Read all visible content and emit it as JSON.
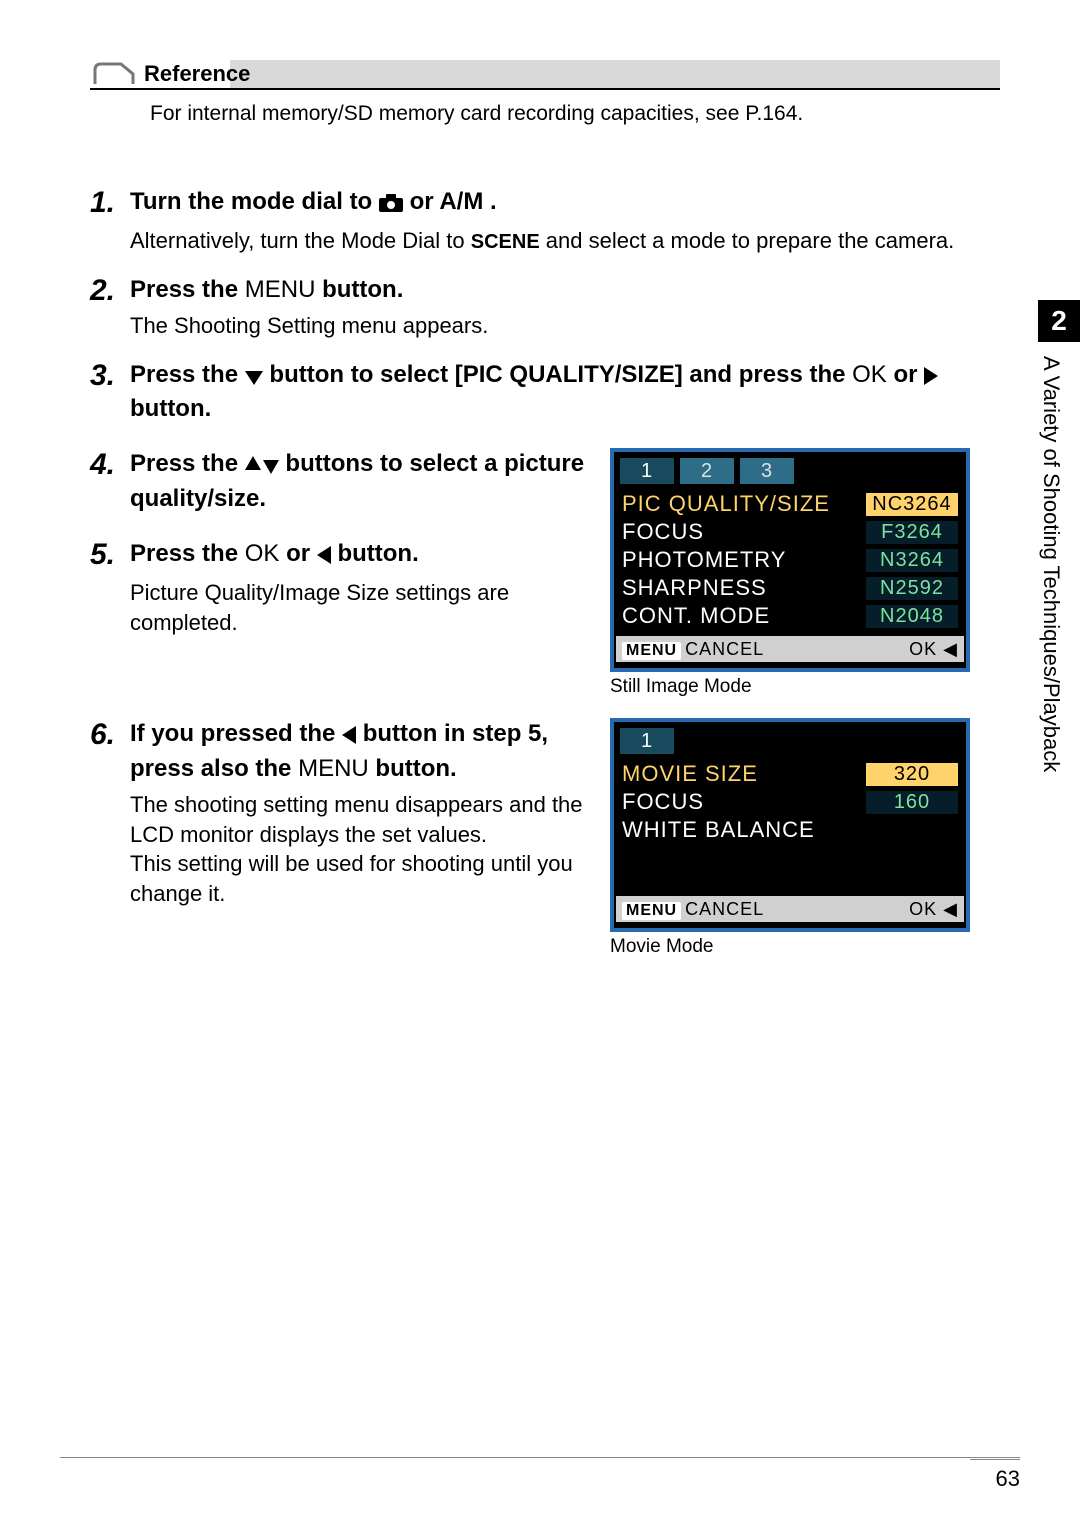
{
  "reference": {
    "title": "Reference",
    "body": "For internal memory/SD memory card recording capacities, see P.164."
  },
  "steps": {
    "1": {
      "head_pre": "Turn the mode dial to ",
      "head_post": " or A/M .",
      "body_pre": "Alternatively, turn the Mode Dial to ",
      "body_scene": "SCENE",
      "body_post": " and select a mode to prepare the camera."
    },
    "2": {
      "head_pre": "Press the ",
      "head_menu": "MENU",
      "head_post": " button.",
      "body": "The Shooting Setting menu appears."
    },
    "3": {
      "head_pre": "Press the ",
      "head_mid": "button to select [PIC QUALITY/SIZE] and press the ",
      "head_ok": "OK",
      "head_or": " or ",
      "head_post": " button."
    },
    "4": {
      "head_pre": "Press the ",
      "head_post": " buttons to select a picture quality/size."
    },
    "5": {
      "head_pre": "Press the ",
      "head_ok": "OK",
      "head_or": " or ",
      "head_post": " button.",
      "body": "Picture Quality/Image Size settings are completed."
    },
    "6": {
      "head_pre": "If you pressed the ",
      "head_mid": " button in step 5, press also the ",
      "head_menu": "MENU",
      "head_post": " button.",
      "body": "The shooting setting menu disappears and the LCD monitor displays the set values.\nThis setting will be used for shooting until you change it."
    }
  },
  "lcd1": {
    "tabs": [
      "1",
      "2",
      "3"
    ],
    "rows": [
      {
        "name": "PIC QUALITY/SIZE",
        "val": "NC3264",
        "sel": true
      },
      {
        "name": "FOCUS",
        "val": "F3264"
      },
      {
        "name": "PHOTOMETRY",
        "val": "N3264"
      },
      {
        "name": "SHARPNESS",
        "val": "N2592"
      },
      {
        "name": "CONT. MODE",
        "val": "N2048"
      }
    ],
    "footer_menu": "MENU",
    "footer_cancel": "CANCEL",
    "footer_ok": "OK",
    "caption": "Still Image Mode"
  },
  "lcd2": {
    "tabs": [
      "1"
    ],
    "rows": [
      {
        "name": "MOVIE SIZE",
        "val": "320",
        "sel": true
      },
      {
        "name": "FOCUS",
        "val": "160"
      },
      {
        "name": "WHITE BALANCE",
        "val": ""
      }
    ],
    "footer_menu": "MENU",
    "footer_cancel": "CANCEL",
    "footer_ok": "OK",
    "caption": "Movie Mode"
  },
  "side": {
    "chapter": "2",
    "title": "A Variety of Shooting Techniques/Playback"
  },
  "page_number": "63"
}
